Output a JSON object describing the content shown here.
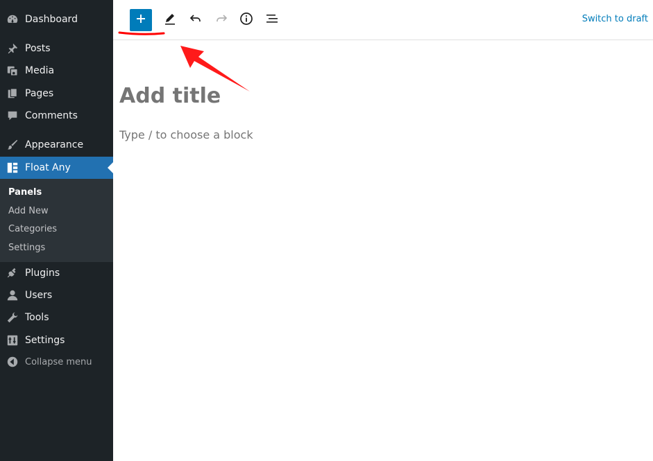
{
  "sidebar": {
    "items": [
      {
        "label": "Dashboard",
        "icon": "dashboard-icon"
      },
      {
        "label": "Posts",
        "icon": "pin-icon"
      },
      {
        "label": "Media",
        "icon": "media-icon"
      },
      {
        "label": "Pages",
        "icon": "pages-icon"
      },
      {
        "label": "Comments",
        "icon": "comments-icon"
      },
      {
        "label": "Appearance",
        "icon": "brush-icon"
      },
      {
        "label": "Float Any",
        "icon": "grid-icon"
      },
      {
        "label": "Plugins",
        "icon": "plugin-icon"
      },
      {
        "label": "Users",
        "icon": "user-icon"
      },
      {
        "label": "Tools",
        "icon": "wrench-icon"
      },
      {
        "label": "Settings",
        "icon": "settings-icon"
      }
    ],
    "submenu": [
      "Panels",
      "Add New",
      "Categories",
      "Settings"
    ],
    "collapse_label": "Collapse menu"
  },
  "toolbar": {
    "switch_to_draft": "Switch to draft"
  },
  "editor": {
    "title_placeholder": "Add title",
    "block_placeholder": "Type / to choose a block"
  },
  "colors": {
    "sidebar_bg": "#1d2327",
    "active": "#2271b1",
    "accent": "#007cba",
    "annotation": "#ff0000"
  }
}
